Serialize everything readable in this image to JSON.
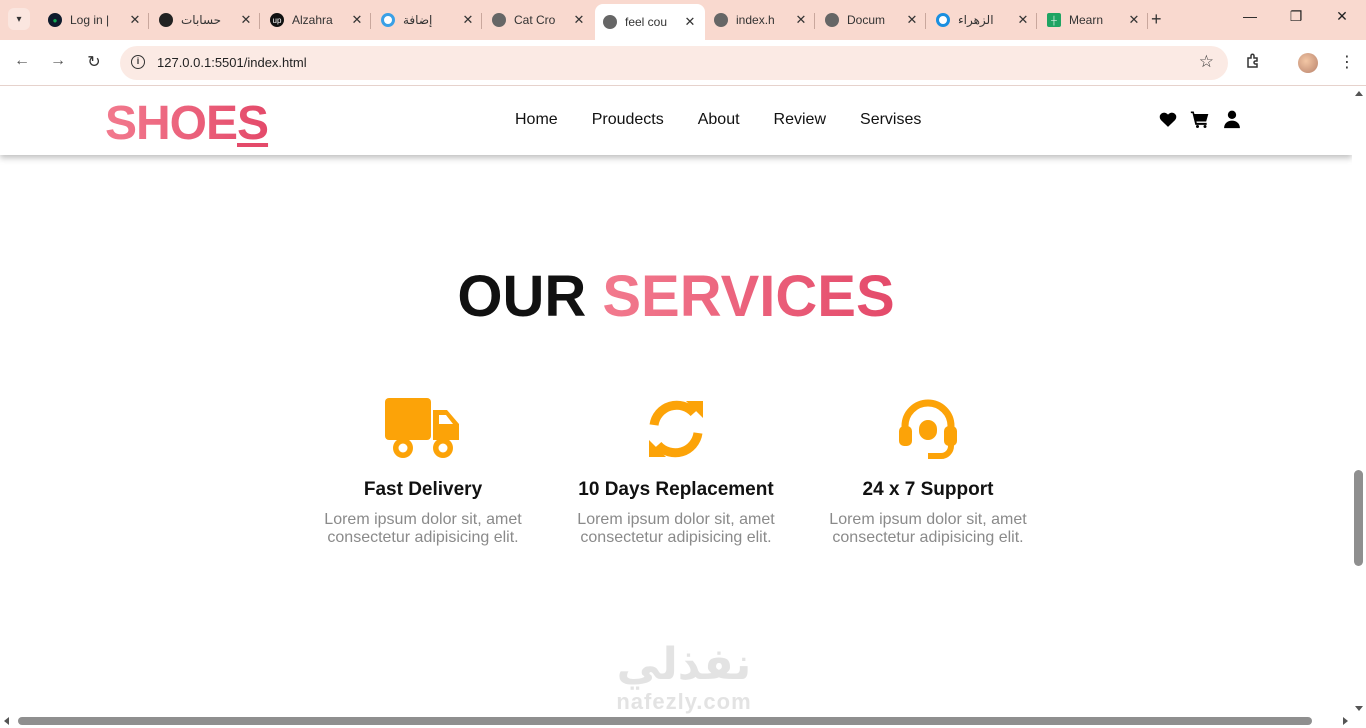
{
  "browser": {
    "tabs": [
      {
        "label": "Log in |",
        "fav_color": "#0f1b2d",
        "icon": "mongodb-leaf-icon"
      },
      {
        "label": "حسابات",
        "fav_color": "#222222",
        "icon": "circle-logo-icon"
      },
      {
        "label": "Alzahra",
        "fav_color": "#111111",
        "icon": "upwork-icon"
      },
      {
        "label": "إضافة",
        "fav_color": "#3aa0e6",
        "icon": "ring-icon"
      },
      {
        "label": "Cat Cro",
        "fav_color": "#666666",
        "icon": "globe-icon"
      },
      {
        "label": "feel cou",
        "fav_color": "#666666",
        "icon": "globe-icon"
      },
      {
        "label": "index.h",
        "fav_color": "#666666",
        "icon": "globe-icon"
      },
      {
        "label": "Docum",
        "fav_color": "#666666",
        "icon": "globe-icon"
      },
      {
        "label": "الزهراء",
        "fav_color": "#1a8fe0",
        "icon": "swirl-icon"
      },
      {
        "label": "Mearn",
        "fav_color": "#1fa463",
        "icon": "sheets-icon"
      }
    ],
    "active_tab_index": 5,
    "url": "127.0.0.1:5501/index.html"
  },
  "site": {
    "logo_main": "SHOE",
    "logo_last": "S",
    "nav": [
      "Home",
      "Proudects",
      "About",
      "Review",
      "Servises"
    ],
    "header_icons": [
      "heart-icon",
      "cart-icon",
      "user-icon"
    ]
  },
  "services": {
    "title_part1": "OUR",
    "title_part2": "SERVICES",
    "accent_color": "#e85a78",
    "icon_color": "#fca308",
    "items": [
      {
        "title": "Fast Delivery",
        "text": "Lorem ipsum dolor sit, amet consectetur adipisicing elit.",
        "icon": "truck-icon"
      },
      {
        "title": "10 Days Replacement",
        "text": "Lorem ipsum dolor sit, amet consectetur adipisicing elit.",
        "icon": "sync-icon"
      },
      {
        "title": "24 x 7 Support",
        "text": "Lorem ipsum dolor sit, amet consectetur adipisicing elit.",
        "icon": "headset-icon"
      }
    ]
  },
  "watermark": {
    "arabic": "نفذلي",
    "latin": "nafezly.com"
  }
}
